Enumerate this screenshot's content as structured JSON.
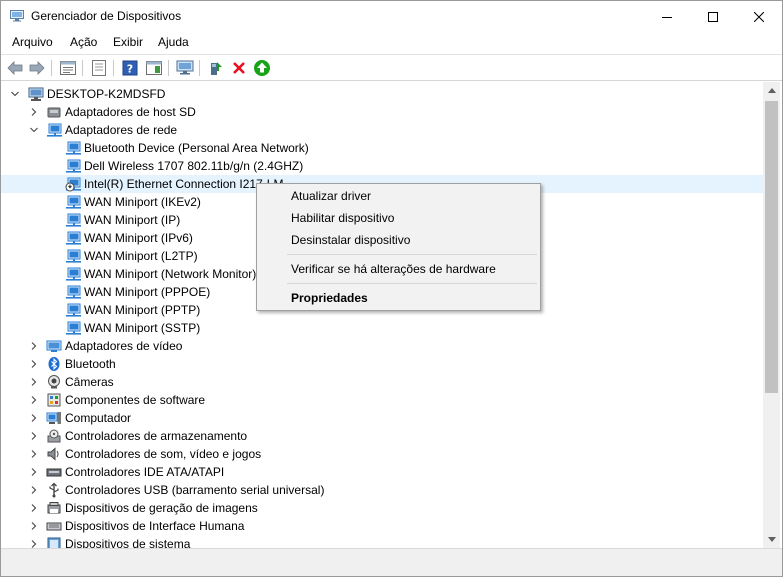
{
  "window": {
    "title": "Gerenciador de Dispositivos"
  },
  "menu": [
    "Arquivo",
    "Ação",
    "Exibir",
    "Ajuda"
  ],
  "toolbar_icons": [
    "back-icon",
    "forward-icon",
    "properties-icon",
    "show-hide-icon",
    "help-icon",
    "action-pane-icon",
    "monitor-scan-icon",
    "add-driver-icon",
    "uninstall-icon",
    "update-driver-icon"
  ],
  "tree": {
    "root": "DESKTOP-K2MDSFD",
    "categories": [
      {
        "label": "Adaptadores de host SD",
        "expanded": false
      },
      {
        "label": "Adaptadores de rede",
        "expanded": true,
        "children": [
          "Bluetooth Device (Personal Area Network)",
          "Dell Wireless 1707 802.11b/g/n (2.4GHZ)",
          "Intel(R) Ethernet Connection I217-LM",
          "WAN Miniport (IKEv2)",
          "WAN Miniport (IP)",
          "WAN Miniport (IPv6)",
          "WAN Miniport (L2TP)",
          "WAN Miniport (Network Monitor)",
          "WAN Miniport (PPPOE)",
          "WAN Miniport (PPTP)",
          "WAN Miniport (SSTP)"
        ]
      },
      {
        "label": "Adaptadores de vídeo",
        "expanded": false
      },
      {
        "label": "Bluetooth",
        "expanded": false
      },
      {
        "label": "Câmeras",
        "expanded": false
      },
      {
        "label": "Componentes de software",
        "expanded": false
      },
      {
        "label": "Computador",
        "expanded": false
      },
      {
        "label": "Controladores de armazenamento",
        "expanded": false
      },
      {
        "label": "Controladores de som, vídeo e jogos",
        "expanded": false
      },
      {
        "label": "Controladores IDE ATA/ATAPI",
        "expanded": false
      },
      {
        "label": "Controladores USB (barramento serial universal)",
        "expanded": false
      },
      {
        "label": "Dispositivos de geração de imagens",
        "expanded": false
      },
      {
        "label": "Dispositivos de Interface Humana",
        "expanded": false
      },
      {
        "label": "Dispositivos de sistema",
        "expanded": false
      }
    ]
  },
  "context_menu": {
    "items": [
      "Atualizar driver",
      "Habilitar dispositivo",
      "Desinstalar dispositivo",
      "Verificar se há alterações de hardware",
      "Propriedades"
    ]
  },
  "colors": {
    "selection": "#e5f3ff",
    "network_icon": "#2a7fd4",
    "delete_red": "#e81123",
    "update_green": "#17a317"
  }
}
